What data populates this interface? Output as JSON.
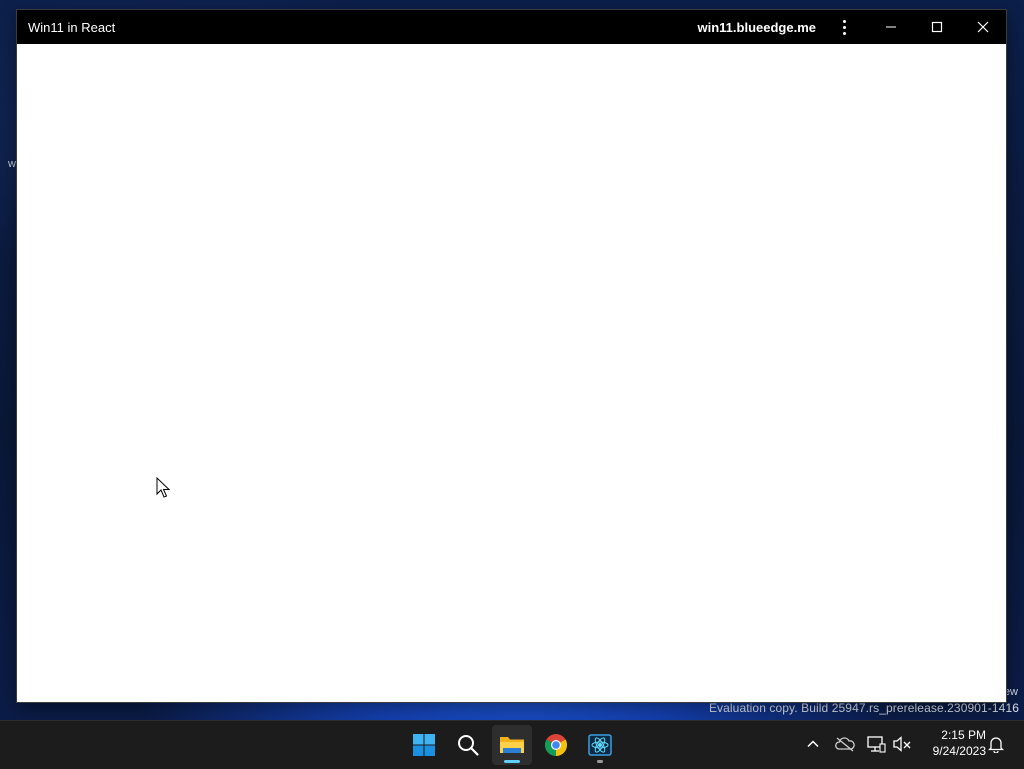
{
  "window": {
    "title": "Win11 in React",
    "url": "win11.blueedge.me"
  },
  "desktop": {
    "stray_left_text": "w",
    "stray_right_text": "ew",
    "watermark": "Evaluation copy. Build 25947.rs_prerelease.230901-1416"
  },
  "taskbar": {
    "apps": [
      {
        "name": "Start",
        "icon": "windows-logo-icon"
      },
      {
        "name": "Search",
        "icon": "search-icon"
      },
      {
        "name": "File Explorer",
        "icon": "folder-icon",
        "active": true
      },
      {
        "name": "Google Chrome",
        "icon": "chrome-icon"
      },
      {
        "name": "Win11 in React",
        "icon": "app-icon",
        "running": true
      }
    ],
    "tray": {
      "icons": [
        "chevron-up-icon",
        "onedrive-offline-icon",
        "network-icon",
        "volume-muted-icon",
        "notification-bell-icon"
      ]
    },
    "clock": {
      "time": "2:15 PM",
      "date": "9/24/2023"
    }
  },
  "colors": {
    "accent": "#60cdff",
    "taskbar_bg": "#1c1c1c",
    "titlebar_bg": "#000000"
  }
}
